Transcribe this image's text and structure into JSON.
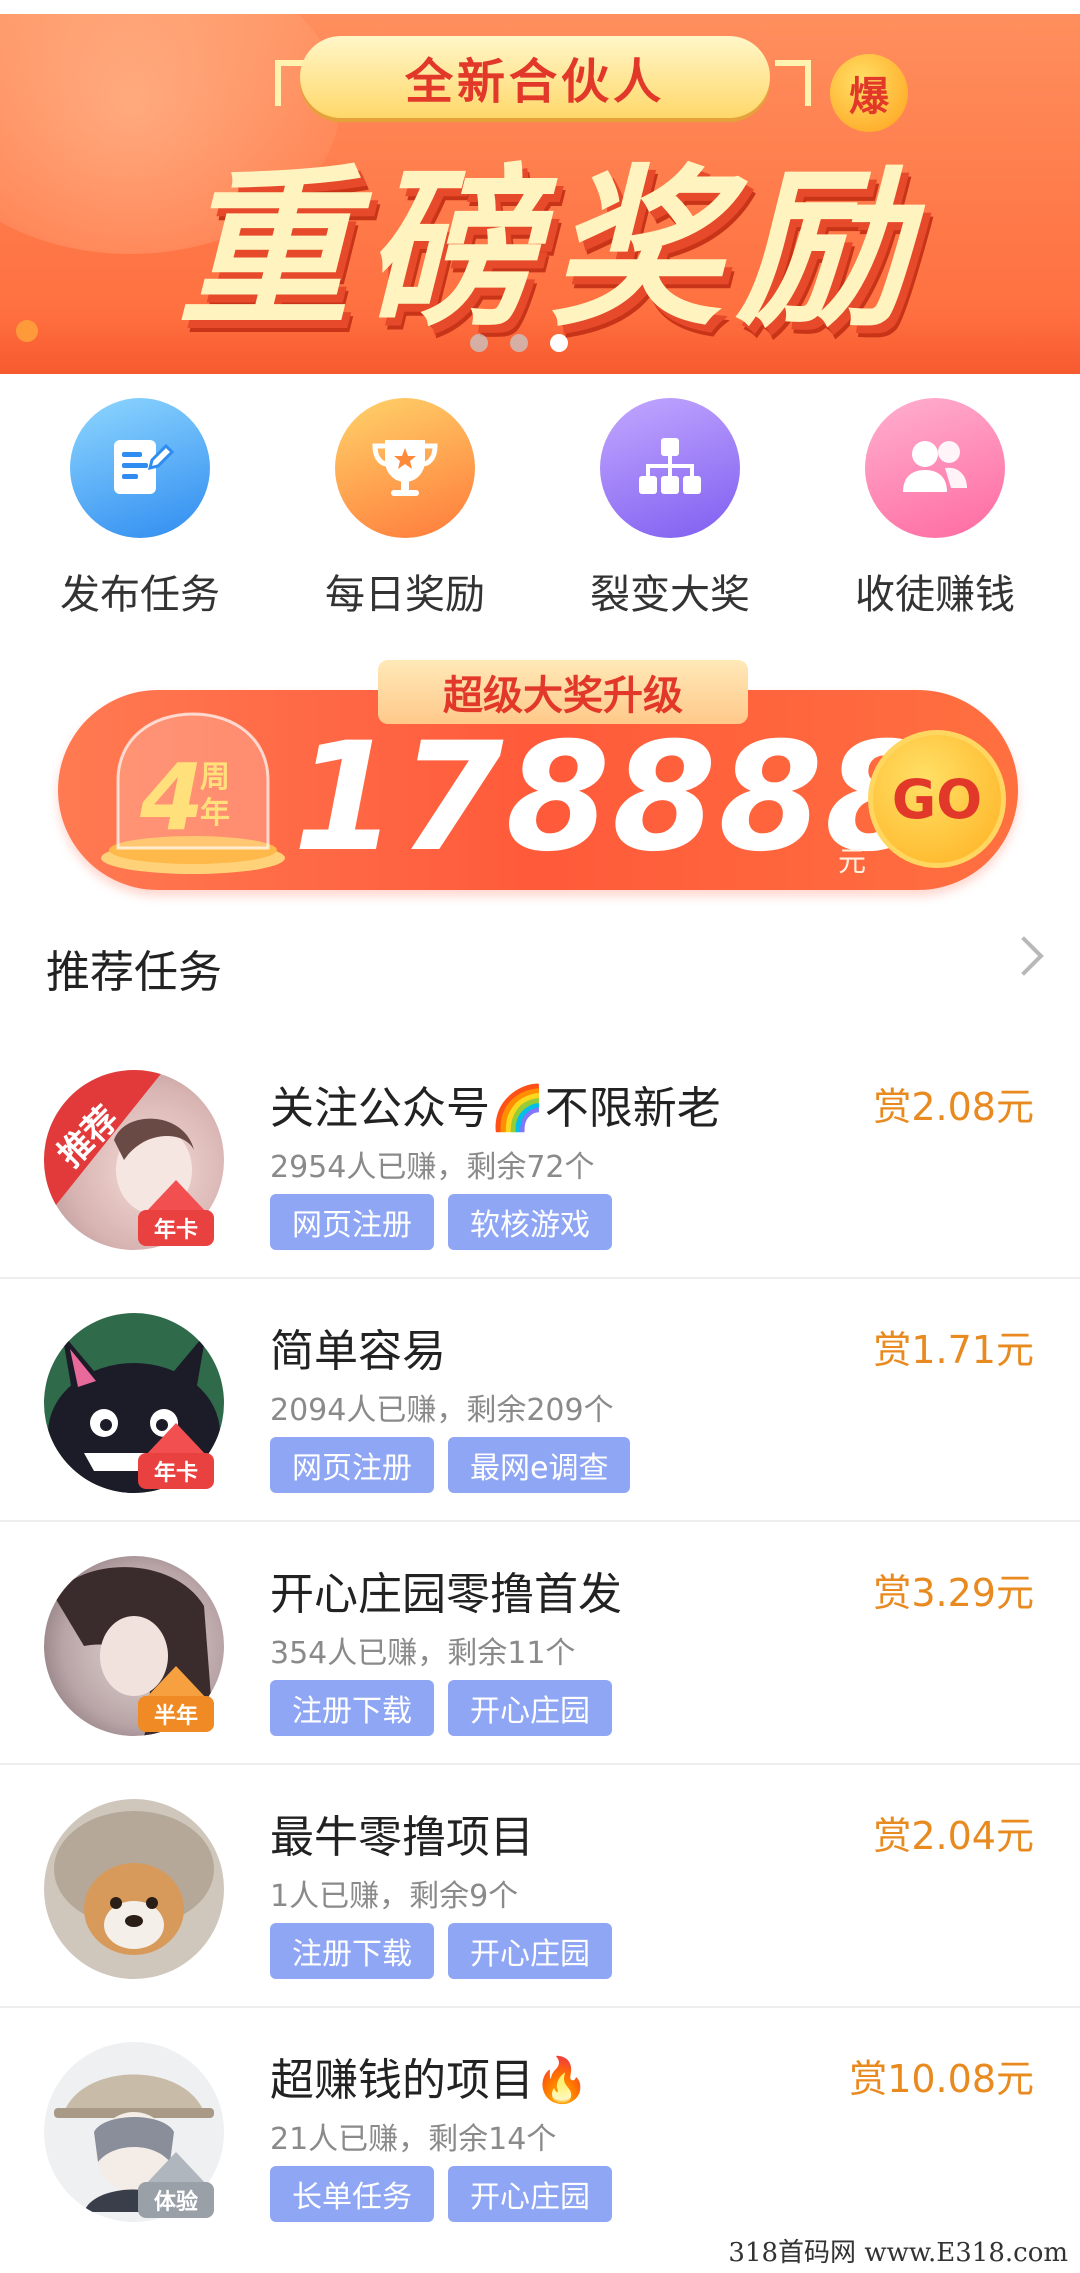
{
  "banner": {
    "pill_text": "全新合伙人",
    "badge_text": "爆",
    "title": "重磅奖励",
    "page_dots": 3,
    "active_dot": 2
  },
  "actions": [
    {
      "label": "发布任务",
      "icon": "edit-document-icon",
      "color": "#2f8cf0"
    },
    {
      "label": "每日奖励",
      "icon": "trophy-icon",
      "color": "#ff7a3a"
    },
    {
      "label": "裂变大奖",
      "icon": "hierarchy-icon",
      "color": "#7f5ef0"
    },
    {
      "label": "收徒赚钱",
      "icon": "users-icon",
      "color": "#ff6aa0"
    }
  ],
  "promo": {
    "tag": "超级大奖升级",
    "anniversary_number": "4",
    "anniversary_text": "周年",
    "amount": "178888",
    "unit": "元",
    "go_label": "GO"
  },
  "section": {
    "title": "推荐任务"
  },
  "tasks": [
    {
      "title": "关注公众号🌈不限新老",
      "stats": "2954人已赚，剩余72个",
      "tags": [
        "网页注册",
        "软核游戏"
      ],
      "reward": "赏2.08元",
      "badge": "年卡",
      "ribbon": "推荐"
    },
    {
      "title": "简单容易",
      "stats": "2094人已赚，剩余209个",
      "tags": [
        "网页注册",
        "最网e调查"
      ],
      "reward": "赏1.71元",
      "badge": "年卡"
    },
    {
      "title": "开心庄园零撸首发",
      "stats": "354人已赚，剩余11个",
      "tags": [
        "注册下载",
        "开心庄园"
      ],
      "reward": "赏3.29元",
      "badge": "半年"
    },
    {
      "title": "最牛零撸项目",
      "stats": "1人已赚，剩余9个",
      "tags": [
        "注册下载",
        "开心庄园"
      ],
      "reward": "赏2.04元",
      "badge": ""
    },
    {
      "title": "超赚钱的项目🔥",
      "stats": "21人已赚，剩余14个",
      "tags": [
        "长单任务",
        "开心庄园"
      ],
      "reward": "赏10.08元",
      "badge": "体验"
    }
  ],
  "watermark": "318首码网 www.E318.com"
}
